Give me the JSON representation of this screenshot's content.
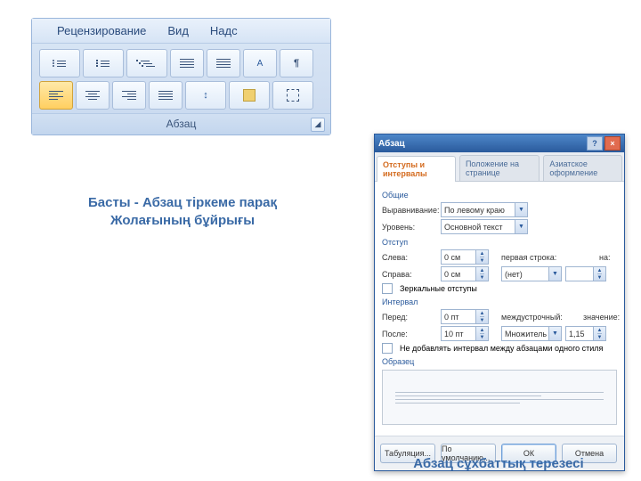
{
  "ribbon": {
    "tabs": [
      "Рецензирование",
      "Вид",
      "Надс"
    ],
    "group_label": "Абзац",
    "icons": {
      "row1": [
        "bullet-list-icon",
        "number-list-icon",
        "multilevel-list-icon",
        "decrease-indent-icon",
        "increase-indent-icon",
        "sort-icon",
        "pilcrow-icon"
      ],
      "row2": [
        "align-left-icon",
        "align-center-icon",
        "align-right-icon",
        "align-justify-icon",
        "line-spacing-icon",
        "shading-icon",
        "borders-icon"
      ]
    },
    "sort_glyph": "А",
    "pilcrow_glyph": "¶"
  },
  "captions": {
    "ribbon": "Басты - Абзац тіркеме парақ\nЖолағының бұйрығы",
    "dialog": "Абзац сұхбаттық терезесі"
  },
  "dialog": {
    "title": "Абзац",
    "help_glyph": "?",
    "close_glyph": "×",
    "tabs": [
      "Отступы и интервалы",
      "Положение на странице",
      "Азиатское оформление"
    ],
    "groups": {
      "general": "Общие",
      "indent": "Отступ",
      "spacing": "Интервал",
      "preview": "Образец"
    },
    "fields": {
      "align_label": "Выравнивание:",
      "align_value": "По левому краю",
      "level_label": "Уровень:",
      "level_value": "Основной текст",
      "left_label": "Слева:",
      "left_value": "0 см",
      "right_label": "Справа:",
      "right_value": "0 см",
      "first_label": "первая строка:",
      "first_value": "(нет)",
      "first_by_label": "на:",
      "first_by_value": "",
      "mirror_label": "Зеркальные отступы",
      "before_label": "Перед:",
      "before_value": "0 пт",
      "after_label": "После:",
      "after_value": "10 пт",
      "line_label": "междустрочный:",
      "line_value": "Множитель",
      "line_by_label": "значение:",
      "line_by_value": "1,15",
      "no_space_label": "Не добавлять интервал между абзацами одного стиля"
    },
    "buttons": {
      "tabs": "Табуляция...",
      "default": "По умолчанию...",
      "ok": "ОК",
      "cancel": "Отмена"
    }
  }
}
